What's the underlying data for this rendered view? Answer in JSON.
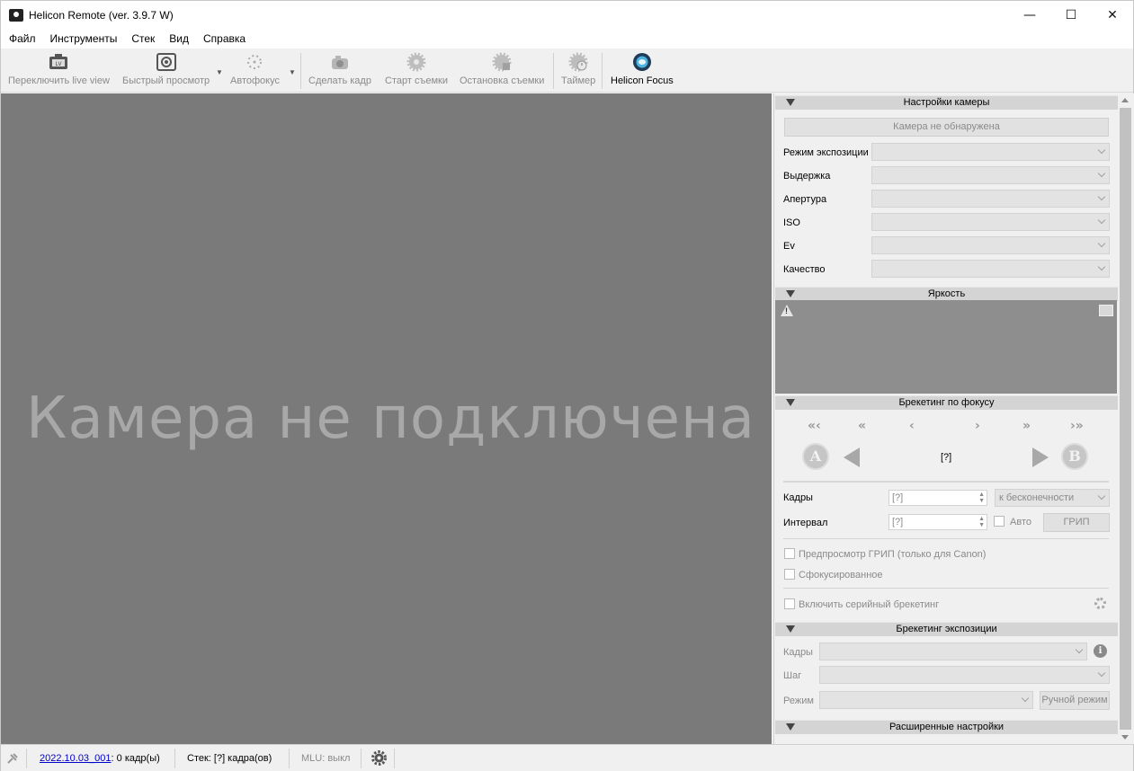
{
  "window": {
    "title": "Helicon Remote (ver. 3.9.7 W)",
    "controls": {
      "minimize": "—",
      "maximize": "☐",
      "close": "✕"
    }
  },
  "menu": [
    "Файл",
    "Инструменты",
    "Стек",
    "Вид",
    "Справка"
  ],
  "toolbar": {
    "live_view": "Переключить live view",
    "quick_preview": "Быстрый просмотр",
    "autofocus": "Автофокус",
    "take_shot": "Сделать кадр",
    "start_shooting": "Старт съемки",
    "stop_shooting": "Остановка съемки",
    "timer": "Таймер",
    "helicon_focus": "Helicon Focus"
  },
  "viewport": {
    "message": "Камера не подключена"
  },
  "camera_settings": {
    "header": "Настройки камеры",
    "status_button": "Камера не обнаружена",
    "rows": [
      "Режим экспозиции",
      "Выдержка",
      "Апертура",
      "ISO",
      "Ev",
      "Качество"
    ]
  },
  "brightness": {
    "header": "Яркость"
  },
  "focus_bracketing": {
    "header": "Брекетинг по фокусу",
    "position": "[?]",
    "btn_a": "A",
    "btn_b": "B",
    "frames_label": "Кадры",
    "frames_value": "[?]",
    "frames_mode": "к бесконечности",
    "interval_label": "Интервал",
    "interval_value": "[?]",
    "auto_label": "Авто",
    "grip_button": "ГРИП",
    "preview_grip": "Предпросмотр ГРИП (только для Canon)",
    "focused": "Сфокусированное",
    "serial_bracketing": "Включить серийный брекетинг"
  },
  "exposure_bracketing": {
    "header": "Брекетинг экспозиции",
    "frames_label": "Кадры",
    "step_label": "Шаг",
    "mode_label": "Режим",
    "manual_mode_button": "Ручной режим"
  },
  "advanced": {
    "header": "Расширенные настройки"
  },
  "statusbar": {
    "session_link": "2022.10.03_001",
    "frames": ": 0 кадр(ы)",
    "stack": "Стек: [?] кадра(ов)",
    "mlu": "MLU: выкл"
  }
}
